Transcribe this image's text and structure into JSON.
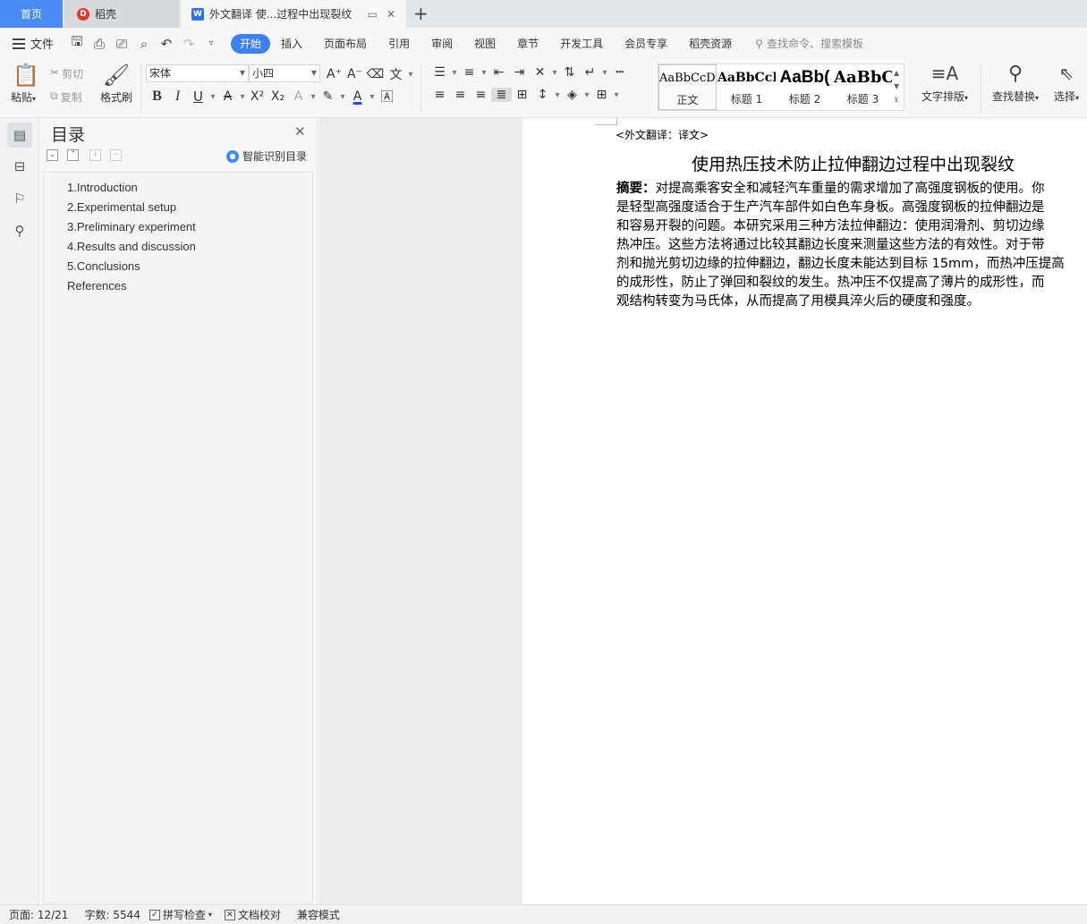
{
  "tabs": {
    "home": "首页",
    "daoke": "稻壳",
    "document": "外文翻译   使...过程中出现裂纹"
  },
  "menubar": {
    "file": "文件",
    "tabs": [
      "开始",
      "插入",
      "页面布局",
      "引用",
      "审阅",
      "视图",
      "章节",
      "开发工具",
      "会员专享",
      "稻壳资源"
    ],
    "active_tab": "开始",
    "search_placeholder": "查找命令、搜索模板"
  },
  "ribbon": {
    "paste": "粘贴",
    "cut": "剪切",
    "copy": "复制",
    "format_painter": "格式刷",
    "font_name": "宋体",
    "font_size": "小四",
    "styles": [
      {
        "preview": "AaBbCcDd",
        "name": "正文"
      },
      {
        "preview": "AaBbCcI",
        "name": "标题 1"
      },
      {
        "preview": "AaBb(",
        "name": "标题 2"
      },
      {
        "preview": "AaBbC",
        "name": "标题 3"
      }
    ],
    "text_layout": "文字排版",
    "find_replace": "查找替换",
    "select": "选择"
  },
  "nav": {
    "title": "目录",
    "smart_toc": "智能识别目录",
    "items": [
      "1.Introduction",
      "2.Experimental setup",
      "3.Preliminary experiment",
      "4.Results and discussion",
      "5.Conclusions",
      "References"
    ]
  },
  "document": {
    "header": "<外文翻译：译文>",
    "title": "使用热压技术防止拉伸翻边过程中出现裂纹",
    "abstract_label": "摘要：",
    "abstract_lines": [
      "对提高乘客安全和减轻汽车重量的需求增加了高强度钢板的使用。你",
      "是轻型高强度适合于生产汽车部件如白色车身板。高强度钢板的拉伸翻边是",
      "和容易开裂的问题。本研究采用三种方法拉伸翻边：使用润滑剂、剪切边缘",
      "热冲压。这些方法将通过比较其翻边长度来测量这些方法的有效性。对于带",
      "剂和抛光剪切边缘的拉伸翻边，翻边长度未能达到目标 15mm，而热冲压提高",
      "的成形性，防止了弹回和裂纹的发生。热冲压不仅提高了薄片的成形性，而",
      "观结构转变为马氏体，从而提高了用模具淬火后的硬度和强度。"
    ]
  },
  "status": {
    "page": "页面: 12/21",
    "words": "字数: 5544",
    "spell": "拼写检查",
    "proof": "文档校对",
    "compat": "兼容模式"
  }
}
